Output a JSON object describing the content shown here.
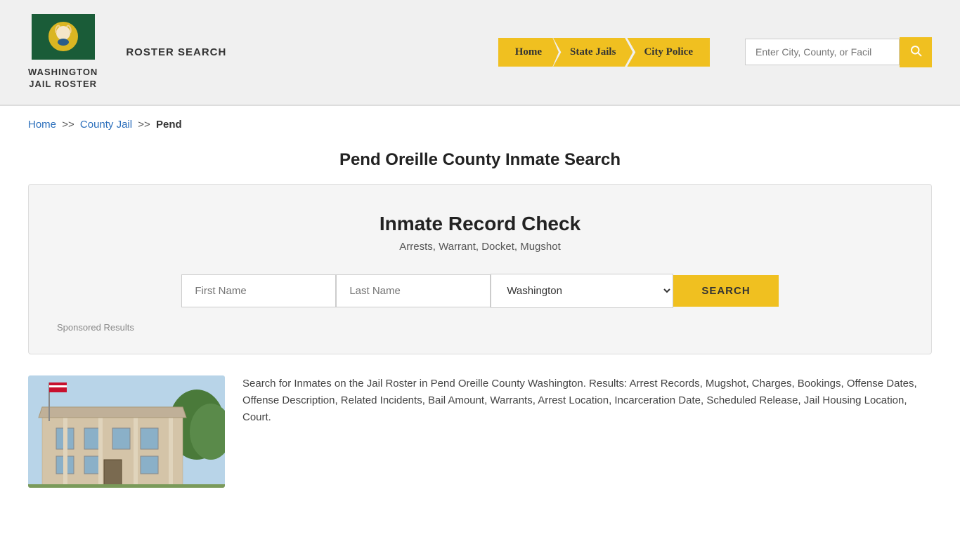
{
  "header": {
    "logo_line1": "WASHINGTON",
    "logo_line2": "JAIL ROSTER",
    "roster_search_label": "ROSTER SEARCH",
    "nav": [
      {
        "label": "Home",
        "id": "home"
      },
      {
        "label": "State Jails",
        "id": "state-jails"
      },
      {
        "label": "City Police",
        "id": "city-police"
      }
    ],
    "search_placeholder": "Enter City, County, or Facil"
  },
  "breadcrumb": {
    "home": "Home",
    "sep1": ">>",
    "county_jail": "County Jail",
    "sep2": ">>",
    "current": "Pend"
  },
  "page_title": "Pend Oreille County Inmate Search",
  "record_check": {
    "title": "Inmate Record Check",
    "subtitle": "Arrests, Warrant, Docket, Mugshot",
    "first_name_placeholder": "First Name",
    "last_name_placeholder": "Last Name",
    "state_default": "Washington",
    "search_btn": "SEARCH",
    "sponsored_results": "Sponsored Results"
  },
  "info_text": "Search for Inmates on the Jail Roster in Pend Oreille County Washington. Results: Arrest Records, Mugshot, Charges, Bookings, Offense Dates, Offense Description, Related Incidents, Bail Amount, Warrants, Arrest Location, Incarceration Date, Scheduled Release, Jail Housing Location, Court."
}
